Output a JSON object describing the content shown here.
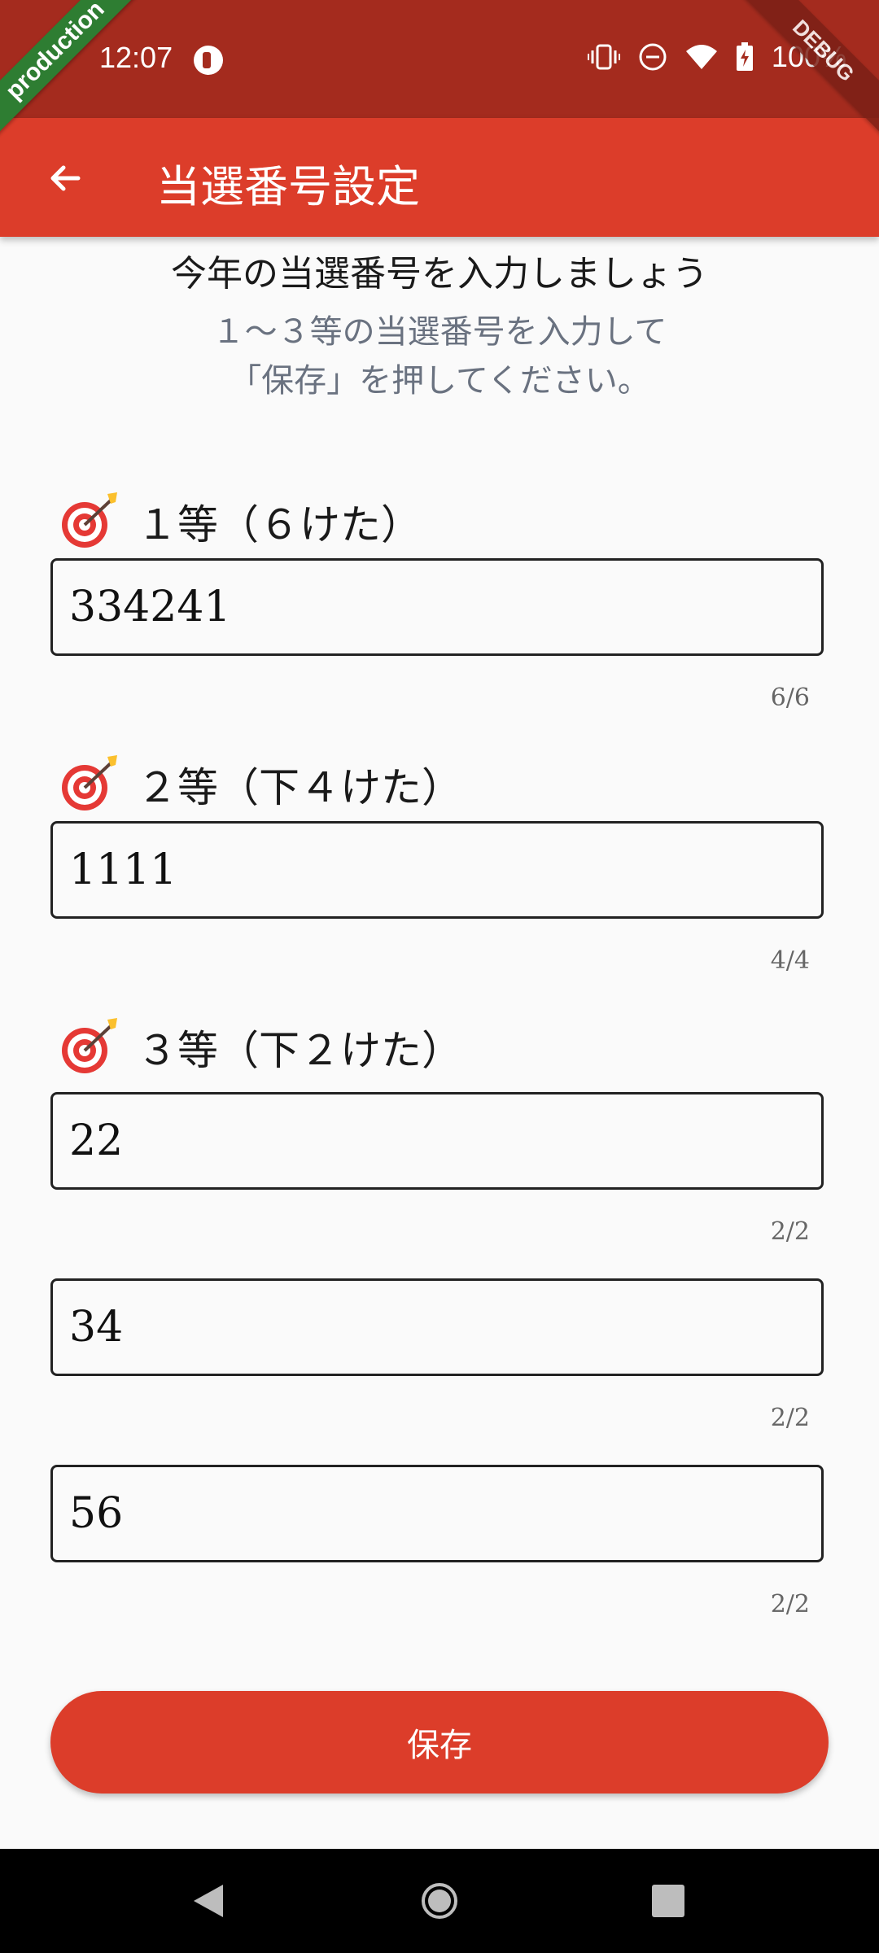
{
  "status_bar": {
    "time": "12:07",
    "battery": "100%",
    "icons": [
      "vibrate-icon",
      "dnd-icon",
      "wifi-icon",
      "battery-charging-icon"
    ]
  },
  "ribbons": {
    "left": "production",
    "right": "DEBUG"
  },
  "app_bar": {
    "title": "当選番号設定",
    "back_icon": "arrow-left-icon"
  },
  "intro": {
    "heading": "今年の当選番号を入力しましょう",
    "line1": "１〜３等の当選番号を入力して",
    "line2": "「保存」を押してください。"
  },
  "sections": [
    {
      "label": "１等（６けた）",
      "icon": "target-icon",
      "fields": [
        {
          "value": "334241",
          "counter": "6/6"
        }
      ]
    },
    {
      "label": "２等（下４けた）",
      "icon": "target-icon",
      "fields": [
        {
          "value": "1111",
          "counter": "4/4"
        }
      ]
    },
    {
      "label": "３等（下２けた）",
      "icon": "target-icon",
      "fields": [
        {
          "value": "22",
          "counter": "2/2"
        },
        {
          "value": "34",
          "counter": "2/2"
        },
        {
          "value": "56",
          "counter": "2/2"
        }
      ]
    }
  ],
  "save_button": {
    "label": "保存"
  },
  "colors": {
    "primary": "#dc3d2a",
    "status_bar": "#a42b1e",
    "background": "#fafafa"
  }
}
